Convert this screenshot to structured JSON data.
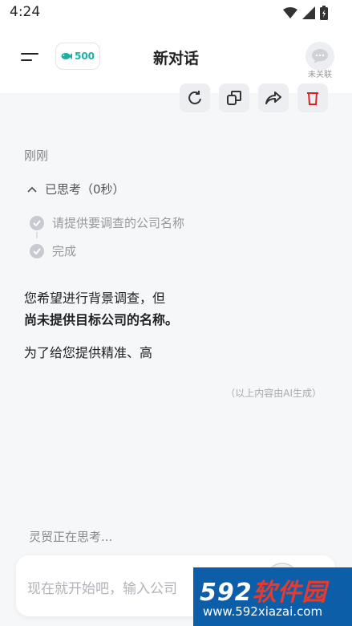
{
  "status_bar": {
    "time": "4:24"
  },
  "header": {
    "title": "新对话",
    "coin_count": "500",
    "avatar_label": "未关联"
  },
  "actions": [
    "refresh-icon",
    "copy-icon",
    "share-icon",
    "delete-icon"
  ],
  "message": {
    "time": "刚刚",
    "thinking_header": "已思考（0秒）",
    "steps": [
      "请提供要调查的公司名称",
      "完成"
    ],
    "answer_line1": "您希望进行背景调查，但",
    "answer_line2": "尚未提供目标公司的名称。",
    "answer_line3": "为了给您提供精准、高",
    "disclaimer": "（以上内容由AI生成）"
  },
  "thinking_status": "灵贸正在思考...",
  "input": {
    "placeholder": "现在就开始吧，输入公司"
  },
  "watermark": {
    "brand_num": "592",
    "brand_text": "软件园",
    "url": "www.592xiazai.com"
  },
  "colors": {
    "accent": "#1bb0a2",
    "delete": "#e02020",
    "watermark_bg": "#0d5ea8"
  }
}
